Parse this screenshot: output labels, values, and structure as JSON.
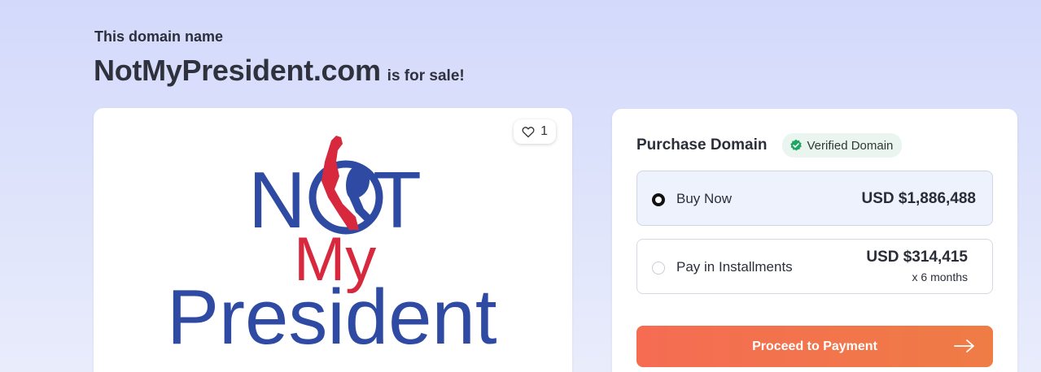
{
  "header": {
    "eyebrow": "This domain name",
    "domain": "NotMyPresident.com",
    "suffix": "is for sale!"
  },
  "logo_card": {
    "like_count": "1",
    "like_icon": "heart-outline-icon",
    "logo_lines": [
      "N",
      "T",
      "My",
      "President"
    ],
    "colors": {
      "blue": "#2f4aa2",
      "red": "#d7283e"
    }
  },
  "purchase": {
    "title": "Purchase Domain",
    "verified_label": "Verified Domain",
    "verified_icon": "check-badge-icon",
    "options": [
      {
        "label": "Buy Now",
        "price": "USD $1,886,488",
        "selected": true
      },
      {
        "label": "Pay in Installments",
        "price": "USD $314,415",
        "sub": "x 6 months",
        "selected": false
      }
    ],
    "cta_label": "Proceed to Payment",
    "cta_icon": "arrow-right-icon",
    "colors": {
      "cta": "#f26e4f",
      "verified_bg": "#e9f5ee",
      "verified_check": "#1fa463"
    }
  }
}
